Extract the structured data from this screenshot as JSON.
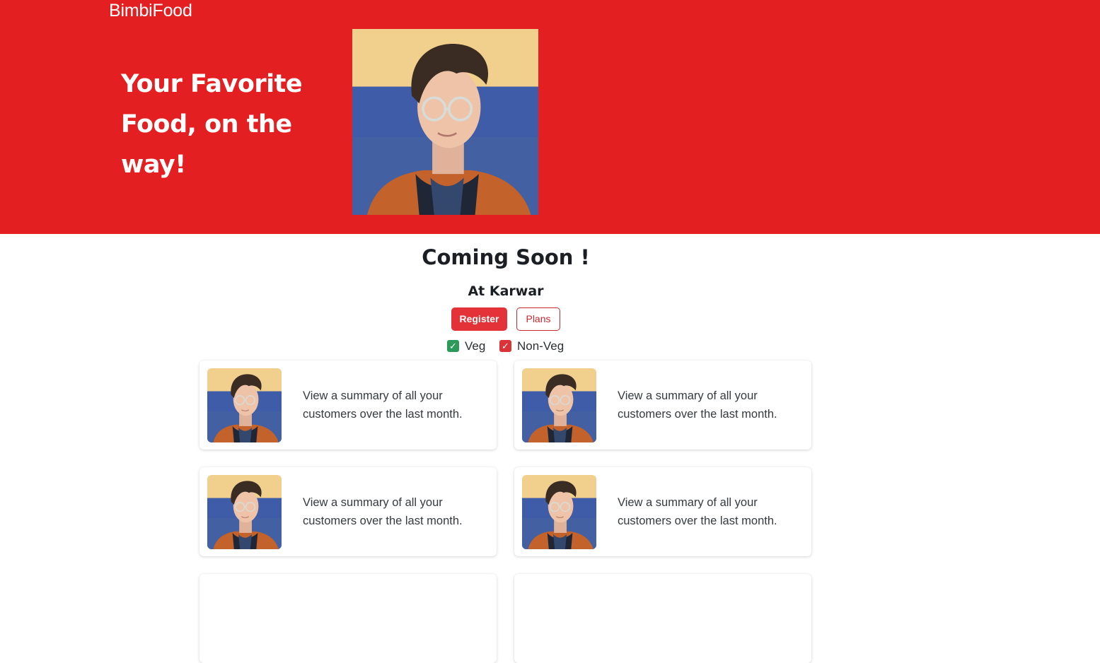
{
  "header": {
    "brand": "BimbiFood",
    "hero_title": "Your Favorite Food, on the way!",
    "hero_image_icon": "portrait-photo"
  },
  "main": {
    "title": "Coming Soon !",
    "location": "At Karwar",
    "register_label": "Register",
    "plans_label": "Plans",
    "filters": [
      {
        "label": "Veg",
        "checked": true,
        "color": "#2e9a5a"
      },
      {
        "label": "Non-Veg",
        "checked": true,
        "color": "#dc3338"
      }
    ],
    "cards": [
      {
        "text": "View a summary of all your customers over the last month."
      },
      {
        "text": "View a summary of all your customers over the last month."
      },
      {
        "text": "View a summary of all your customers over the last month."
      },
      {
        "text": "View a summary of all your customers over the last month."
      }
    ]
  },
  "colors": {
    "brand_red": "#e31f22",
    "register_button": "#e33338",
    "plans_outline": "#c9282d"
  }
}
